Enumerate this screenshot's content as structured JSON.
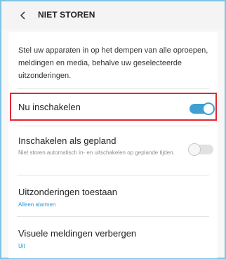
{
  "header": {
    "title": "NIET STOREN",
    "back_icon": "chevron-left-icon"
  },
  "description": "Stel uw apparaten in op het dempen van alle oproepen, meldingen en media, behalve uw geselecteerde uitzonderingen.",
  "settings": [
    {
      "title": "Nu inschakelen",
      "toggle": "on"
    },
    {
      "title": "Inschakelen als gepland",
      "subtitle": "Niet storen automatisch in- en uitschakelen op geplande tijden.",
      "toggle": "off"
    },
    {
      "title": "Uitzonderingen toestaan",
      "subtitle": "Alleen alarmen"
    },
    {
      "title": "Visuele meldingen verbergen",
      "subtitle": "Uit"
    }
  ],
  "colors": {
    "accent": "#3ea0d3",
    "highlight_border": "#e5262f",
    "subtitle_blue": "#2d9ad6"
  }
}
